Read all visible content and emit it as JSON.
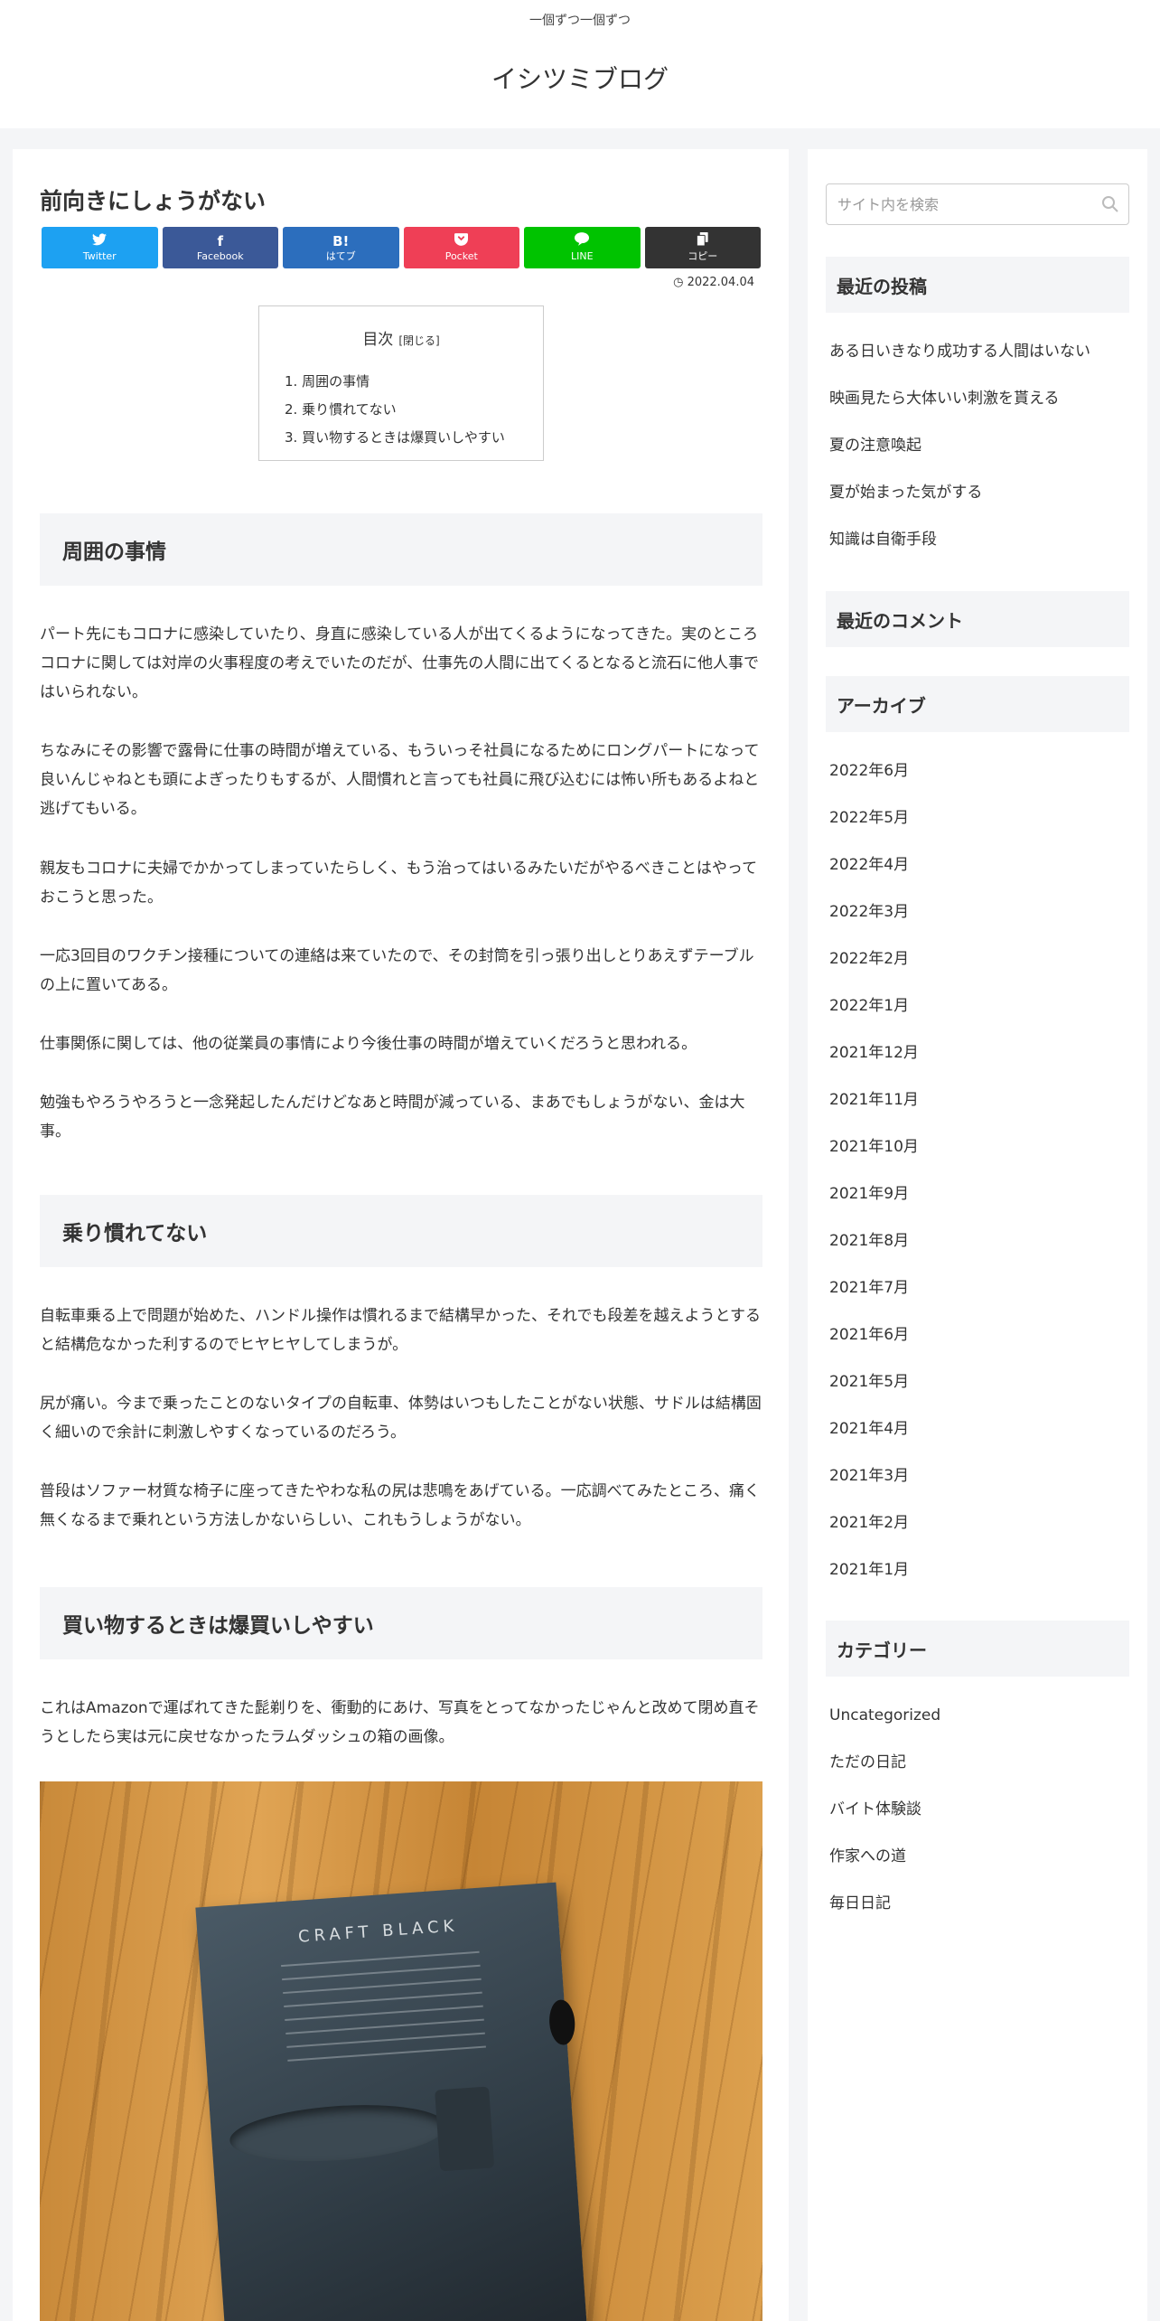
{
  "header": {
    "tagline": "一個ずつ一個ずつ",
    "site_title": "イシツミブログ"
  },
  "article": {
    "title": "前向きにしょうがない",
    "date": "2022.04.04",
    "share": [
      {
        "name": "twitter",
        "label": "Twitter",
        "icon": "🐦",
        "color": "#1da1f2"
      },
      {
        "name": "facebook",
        "label": "Facebook",
        "icon": "f",
        "color": "#3b5998"
      },
      {
        "name": "hatebu",
        "label": "はてブ",
        "icon": "B!",
        "color": "#2c6ebd"
      },
      {
        "name": "pocket",
        "label": "Pocket",
        "icon": "♥",
        "color": "#ef3f56"
      },
      {
        "name": "line",
        "label": "LINE",
        "icon": "●",
        "color": "#00c300"
      },
      {
        "name": "copy",
        "label": "コピー",
        "icon": "⎘",
        "color": "#333333"
      }
    ],
    "toc": {
      "title": "目次",
      "toggle": "[閉じる]",
      "items": [
        "1. 周囲の事情",
        "2. 乗り慣れてない",
        "3. 買い物するときは爆買いしやすい"
      ]
    },
    "sections": [
      {
        "heading": "周囲の事情",
        "paragraphs": [
          "パート先にもコロナに感染していたり、身直に感染している人が出てくるようになってきた。実のところコロナに関しては対岸の火事程度の考えでいたのだが、仕事先の人間に出てくるとなると流石に他人事ではいられない。",
          "ちなみにその影響で露骨に仕事の時間が増えている、もういっそ社員になるためにロングパートになって良いんじゃねとも頭によぎったりもするが、人間慣れと言っても社員に飛び込むには怖い所もあるよねと逃げてもいる。",
          "親友もコロナに夫婦でかかってしまっていたらしく、もう治ってはいるみたいだがやるべきことはやっておこうと思った。",
          "一応3回目のワクチン接種についての連絡は来ていたので、その封筒を引っ張り出しとりあえずテーブルの上に置いてある。",
          "仕事関係に関しては、他の従業員の事情により今後仕事の時間が増えていくだろうと思われる。",
          "勉強もやろうやろうと一念発起したんだけどなあと時間が減っている、まあでもしょうがない、金は大事。"
        ]
      },
      {
        "heading": "乗り慣れてない",
        "paragraphs": [
          "自転車乗る上で問題が始めた、ハンドル操作は慣れるまで結構早かった、それでも段差を越えようとすると結構危なかった利するのでヒヤヒヤしてしまうが。",
          "尻が痛い。今まで乗ったことのないタイプの自転車、体勢はいつもしたことがない状態、サドルは結構固く細いので余計に刺激しやすくなっているのだろう。",
          "普段はソファー材質な椅子に座ってきたやわな私の尻は悲鳴をあげている。一応調べてみたところ、痛く無くなるまで乗れという方法しかないらしい、これもうしょうがない。"
        ]
      },
      {
        "heading": "買い物するときは爆買いしやすい",
        "paragraphs": [
          "これはAmazonで運ばれてきた髭剃りを、衝動的にあけ、写真をとってなかったじゃんと改めて閉め直そうとしたら実は元に戻せなかったラムダッシュの箱の画像。"
        ]
      }
    ],
    "photo_box_title": "CRAFT BLACK"
  },
  "sidebar": {
    "search_placeholder": "サイト内を検索",
    "recent_posts_title": "最近の投稿",
    "recent_posts": [
      "ある日いきなり成功する人間はいない",
      "映画見たら大体いい刺激を貰える",
      "夏の注意喚起",
      "夏が始まった気がする",
      "知識は自衛手段"
    ],
    "recent_comments_title": "最近のコメント",
    "archives_title": "アーカイブ",
    "archives": [
      "2022年6月",
      "2022年5月",
      "2022年4月",
      "2022年3月",
      "2022年2月",
      "2022年1月",
      "2021年12月",
      "2021年11月",
      "2021年10月",
      "2021年9月",
      "2021年8月",
      "2021年7月",
      "2021年6月",
      "2021年5月",
      "2021年4月",
      "2021年3月",
      "2021年2月",
      "2021年1月"
    ],
    "categories_title": "カテゴリー",
    "categories": [
      "Uncategorized",
      "ただの日記",
      "バイト体験談",
      "作家への道",
      "毎日日記"
    ]
  }
}
